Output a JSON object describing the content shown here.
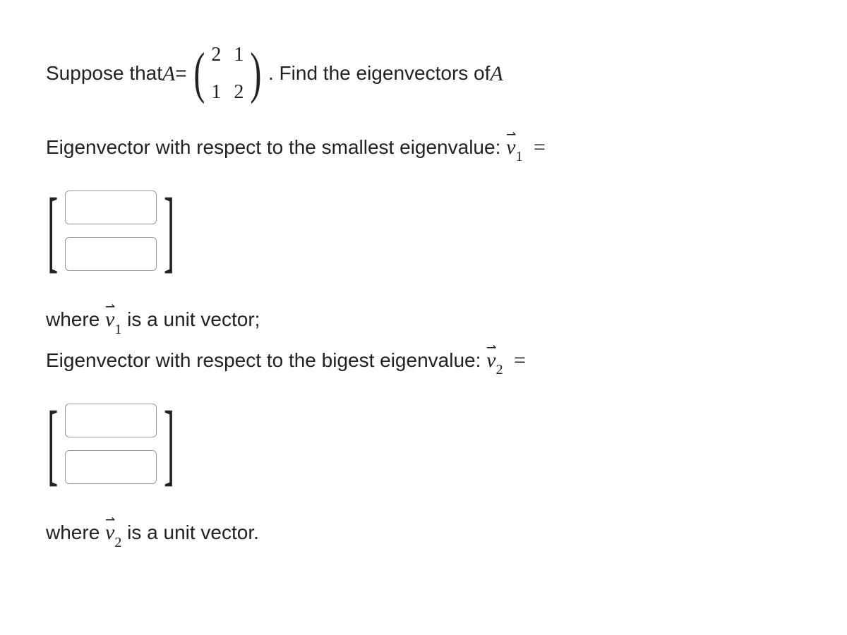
{
  "problem": {
    "prefix": "Suppose that ",
    "matrix_var": "A",
    "equals": " = ",
    "matrix": {
      "r1c1": "2",
      "r1c2": "1",
      "r2c1": "1",
      "r2c2": "2"
    },
    "suffix": ". Find the eigenvectors of ",
    "matrix_var2": "A"
  },
  "q1": {
    "prompt": "Eigenvector with respect to the smallest eigenvalue: ",
    "vec_sym": "v",
    "vec_sub": "1",
    "equals": " =",
    "note_prefix": "where ",
    "note_vec_sym": "v",
    "note_vec_sub": "1",
    "note_suffix": " is a unit vector;"
  },
  "q2": {
    "prompt": "Eigenvector with respect to the bigest eigenvalue: ",
    "vec_sym": "v",
    "vec_sub": "2",
    "equals": " =",
    "note_prefix": "where ",
    "note_vec_sym": "v",
    "note_vec_sub": "2",
    "note_suffix": " is a unit vector."
  },
  "inputs": {
    "v1_a": "",
    "v1_b": "",
    "v2_a": "",
    "v2_b": ""
  }
}
